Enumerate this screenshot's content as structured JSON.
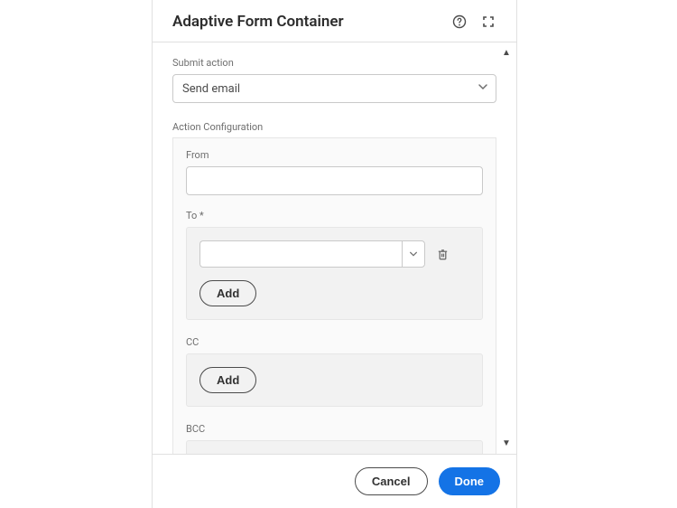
{
  "header": {
    "title": "Adaptive Form Container"
  },
  "submit": {
    "label": "Submit action",
    "selected": "Send email"
  },
  "config": {
    "section_label": "Action Configuration",
    "from_label": "From",
    "from_value": "",
    "to_label": "To *",
    "to_value": "",
    "cc_label": "CC",
    "bcc_label": "BCC",
    "add_label": "Add"
  },
  "footer": {
    "cancel": "Cancel",
    "done": "Done"
  }
}
